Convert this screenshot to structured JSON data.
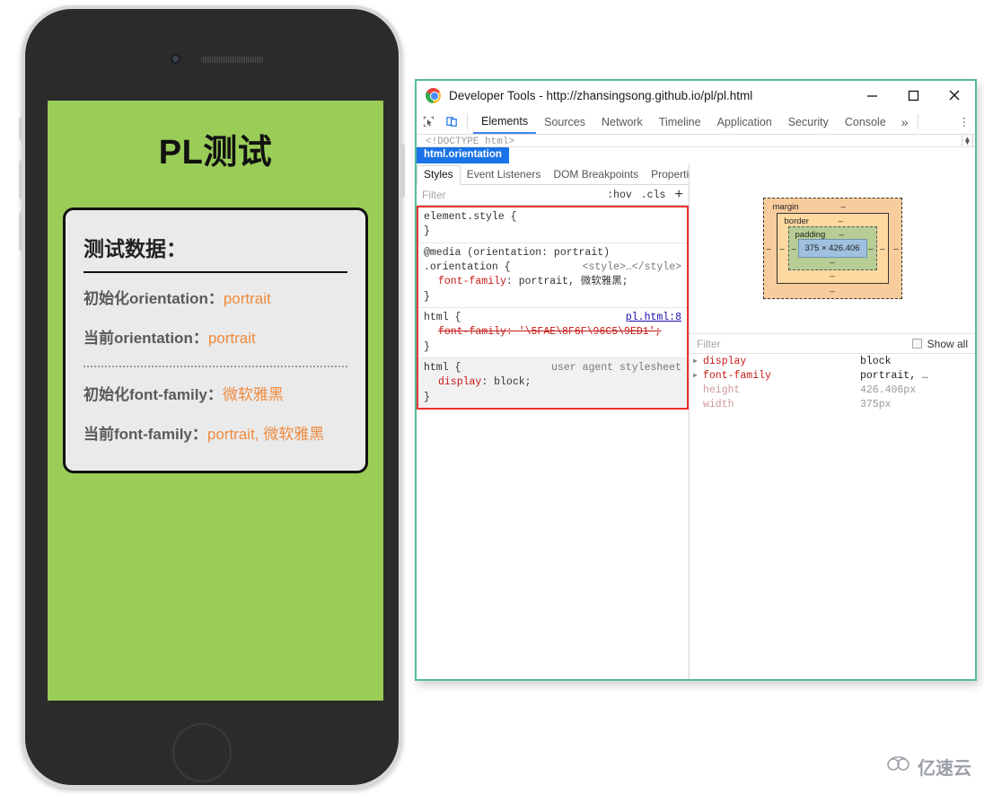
{
  "phone": {
    "device_name": "smartphone-mockup",
    "screen": {
      "title": "PL测试",
      "card": {
        "heading": "测试数据：",
        "rows": [
          {
            "label": "初始化orientation",
            "colon": "：",
            "value": "portrait"
          },
          {
            "label": "当前orientation",
            "colon": "：",
            "value": "portrait"
          },
          {
            "label": "初始化font-family",
            "colon": "：",
            "value": "微软雅黑"
          },
          {
            "label": "当前font-family",
            "colon": "：",
            "value": "portrait, 微软雅黑"
          }
        ]
      },
      "background_color": "#9ACD58",
      "card_background": "#eaeaea",
      "value_color": "#ef8b3f"
    }
  },
  "devtools": {
    "window_title": "Developer Tools - http://zhansingsong.github.io/pl/pl.html",
    "border_color": "#56bb9c",
    "window_buttons": {
      "minimize": "—",
      "maximize": "□",
      "close": "✕"
    },
    "toolbar_icons": [
      "inspect-element-icon",
      "device-toolbar-icon"
    ],
    "tabs": [
      {
        "label": "Elements",
        "active": true
      },
      {
        "label": "Sources",
        "active": false
      },
      {
        "label": "Network",
        "active": false
      },
      {
        "label": "Timeline",
        "active": false
      },
      {
        "label": "Application",
        "active": false
      },
      {
        "label": "Security",
        "active": false
      },
      {
        "label": "Console",
        "active": false
      }
    ],
    "more_tabs": "»",
    "kebab": "⋮",
    "dom_tree_line": "<!DOCTYPE html>",
    "breadcrumb": "html.orientation",
    "sub_tabs": [
      {
        "label": "Styles",
        "active": true
      },
      {
        "label": "Event Listeners",
        "active": false
      },
      {
        "label": "DOM Breakpoints",
        "active": false
      },
      {
        "label": "Properties",
        "active": false
      }
    ],
    "styles_filter": {
      "placeholder": "Filter",
      "hov": ":hov",
      "cls": ".cls",
      "add": "+"
    },
    "styles_highlight_color": "#e8352e",
    "style_rules": [
      {
        "selector": "element.style {",
        "source": "",
        "declarations": [],
        "close": "}"
      },
      {
        "media": "@media (orientation: portrait)",
        "selector": ".orientation {",
        "source": "<style>…</style>",
        "declarations": [
          {
            "name": "font-family",
            "value": "portrait, 微软雅黑;",
            "struck": false
          }
        ],
        "close": "}"
      },
      {
        "selector": "html {",
        "source": "pl.html:8",
        "source_is_link": true,
        "declarations": [
          {
            "name": "font-family",
            "value": "'\\5FAE\\8F6F\\96C5\\9ED1';",
            "struck": true
          }
        ],
        "close": "}"
      },
      {
        "selector": "html {",
        "source": "user agent stylesheet",
        "declarations": [
          {
            "name": "display",
            "value": "block;",
            "struck": false
          }
        ],
        "close": "}"
      }
    ],
    "box_model": {
      "margin_label": "margin",
      "margin_top": "–",
      "margin_right": "–",
      "margin_bottom": "–",
      "margin_left": "–",
      "border_label": "border",
      "border_top": "–",
      "border_right": "–",
      "border_bottom": "–",
      "border_left": "–",
      "padding_label": "padding",
      "padding_top": "–",
      "padding_right": "–",
      "padding_bottom": "–",
      "padding_left": "–",
      "content": "375 × 426.406"
    },
    "computed": {
      "filter_placeholder": "Filter",
      "show_all_label": "Show all",
      "properties": [
        {
          "name": "display",
          "value": "block",
          "expandable": true,
          "inherited": false
        },
        {
          "name": "font-family",
          "value": "portrait, …",
          "expandable": true,
          "inherited": false
        },
        {
          "name": "height",
          "value": "426.406px",
          "expandable": false,
          "inherited": true
        },
        {
          "name": "width",
          "value": "375px",
          "expandable": false,
          "inherited": true
        }
      ]
    }
  },
  "watermark": {
    "text": "亿速云",
    "icon": "cloud-icon"
  }
}
